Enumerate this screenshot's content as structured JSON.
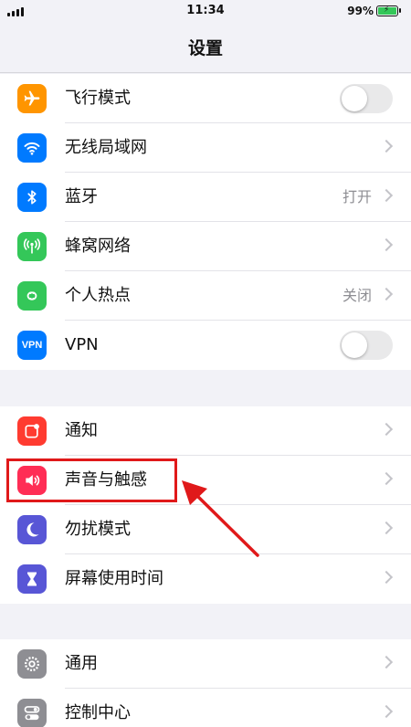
{
  "status_bar": {
    "time": "11:34",
    "battery_percent": "99%"
  },
  "nav": {
    "title": "设置"
  },
  "group1": {
    "items": [
      {
        "label": "飞行模式",
        "icon": "airplane-icon",
        "icon_color": "#ff9500",
        "accessory": "toggle",
        "toggle_on": false
      },
      {
        "label": "无线局域网",
        "icon": "wifi-icon",
        "icon_color": "#007aff",
        "accessory": "chevron"
      },
      {
        "label": "蓝牙",
        "icon": "bluetooth-icon",
        "icon_color": "#007aff",
        "accessory": "chevron",
        "value": "打开"
      },
      {
        "label": "蜂窝网络",
        "icon": "cellular-icon",
        "icon_color": "#34c759",
        "accessory": "chevron"
      },
      {
        "label": "个人热点",
        "icon": "hotspot-icon",
        "icon_color": "#34c759",
        "accessory": "chevron",
        "value": "关闭"
      },
      {
        "label": "VPN",
        "icon": "vpn-icon",
        "icon_color": "#007aff",
        "icon_text": "VPN",
        "accessory": "toggle",
        "toggle_on": false
      }
    ]
  },
  "group2": {
    "items": [
      {
        "label": "通知",
        "icon": "notification-icon",
        "icon_color": "#ff3b30",
        "accessory": "chevron"
      },
      {
        "label": "声音与触感",
        "icon": "speaker-icon",
        "icon_color": "#ff2d55",
        "accessory": "chevron",
        "highlighted": true
      },
      {
        "label": "勿扰模式",
        "icon": "moon-icon",
        "icon_color": "#5856d6",
        "accessory": "chevron"
      },
      {
        "label": "屏幕使用时间",
        "icon": "hourglass-icon",
        "icon_color": "#5856d6",
        "accessory": "chevron"
      }
    ]
  },
  "group3": {
    "items": [
      {
        "label": "通用",
        "icon": "gear-icon",
        "icon_color": "#8e8e93",
        "accessory": "chevron"
      },
      {
        "label": "控制中心",
        "icon": "switches-icon",
        "icon_color": "#8e8e93",
        "accessory": "chevron"
      }
    ]
  },
  "annotation": {
    "color": "#e0191a"
  }
}
